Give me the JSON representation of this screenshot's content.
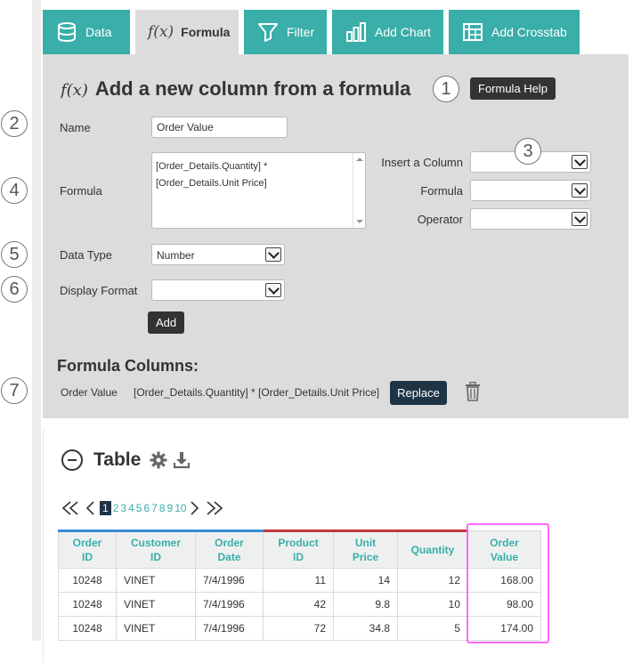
{
  "tabs": [
    {
      "label": "Data",
      "icon": "database-icon"
    },
    {
      "label": "Formula",
      "icon": "fx-icon",
      "fx": "f(x)"
    },
    {
      "label": "Filter",
      "icon": "filter-icon"
    },
    {
      "label": "Add Chart",
      "icon": "bar-chart-icon"
    },
    {
      "label": "Add Crosstab",
      "icon": "crosstab-icon"
    }
  ],
  "panel": {
    "fx": "f(x)",
    "title": "Add a new column from a formula",
    "help_button": "Formula Help",
    "name_label": "Name",
    "name_value": "Order Value",
    "formula_label": "Formula",
    "formula_value_line1": "[Order_Details.Quantity] *",
    "formula_value_line2": "[Order_Details.Unit Price]",
    "insert_column_label": "Insert a Column",
    "insert_formula_label": "Formula",
    "operator_label": "Operator",
    "insert_column_value": "",
    "insert_formula_value": "",
    "operator_value": "",
    "data_type_label": "Data Type",
    "data_type_value": "Number",
    "display_format_label": "Display Format",
    "display_format_value": "",
    "add_button": "Add"
  },
  "formula_columns": {
    "title": "Formula Columns:",
    "items": [
      {
        "name": "Order Value",
        "expression": "[Order_Details.Quantity] * [Order_Details.Unit Price]"
      }
    ],
    "replace_button": "Replace"
  },
  "callouts": [
    "1",
    "2",
    "3",
    "4",
    "5",
    "6",
    "7"
  ],
  "table": {
    "title": "Table",
    "pages": [
      "1",
      "2",
      "3",
      "4",
      "5",
      "6",
      "7",
      "8",
      "9",
      "10"
    ],
    "current_page": "1",
    "columns": [
      {
        "line1": "Order",
        "line2": "ID",
        "accent": "#3a8ad6"
      },
      {
        "line1": "Customer",
        "line2": "ID",
        "accent": "#3a8ad6"
      },
      {
        "line1": "Order",
        "line2": "Date",
        "accent": "#3a8ad6"
      },
      {
        "line1": "Product",
        "line2": "ID",
        "accent": "#c0393b"
      },
      {
        "line1": "Unit",
        "line2": "Price",
        "accent": "#c0393b"
      },
      {
        "line1": "Quantity",
        "line2": "",
        "accent": "#c0393b"
      },
      {
        "line1": "Order",
        "line2": "Value",
        "accent": "#eef0f0"
      }
    ],
    "rows": [
      [
        "10248",
        "VINET",
        "7/4/1996",
        "11",
        "14",
        "12",
        "168.00"
      ],
      [
        "10248",
        "VINET",
        "7/4/1996",
        "42",
        "9.8",
        "10",
        "98.00"
      ],
      [
        "10248",
        "VINET",
        "7/4/1996",
        "72",
        "34.8",
        "5",
        "174.00"
      ]
    ]
  },
  "colors": {
    "tab_teal": "#3aaea9",
    "panel_grey": "#dcdcdc",
    "dark_button": "#333333",
    "replace_button": "#1f3546",
    "highlight": "#ff66ff"
  }
}
